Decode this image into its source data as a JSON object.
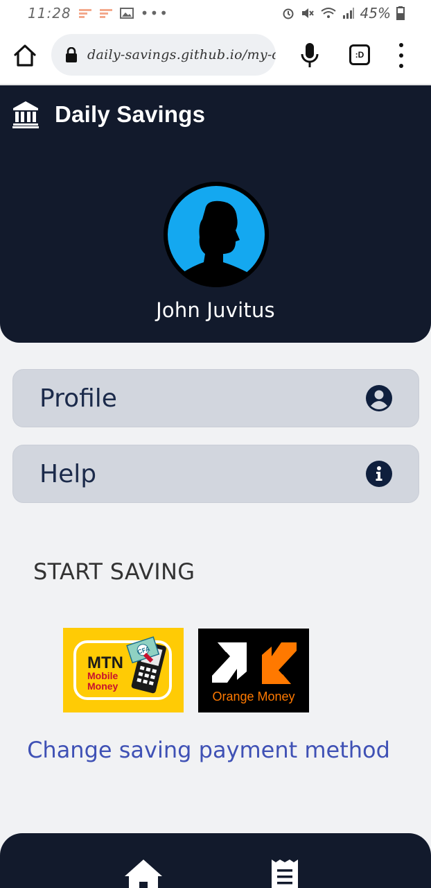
{
  "status_bar": {
    "time": "11:28",
    "battery": "45%"
  },
  "browser": {
    "url": "daily-savings.github.io/my-d",
    "tab_label": ":D"
  },
  "header": {
    "app_title": "Daily Savings",
    "user_name": "John Juvitus"
  },
  "menu": {
    "profile_label": "Profile",
    "help_label": "Help"
  },
  "saving": {
    "section_title": "START SAVING",
    "mtn_line1": "MTN",
    "mtn_line2": "Mobile",
    "mtn_line3": "Money",
    "mtn_badge": "CFA",
    "orange_label": "Orange Money",
    "change_link": "Change saving payment method"
  },
  "colors": {
    "header_bg": "#121a2c",
    "page_bg": "#f1f2f4",
    "card_bg": "#d2d6de",
    "card_text": "#1b2a4a",
    "link": "#3f51b5",
    "avatar_bg": "#14a8f0",
    "mtn_yellow": "#ffcb05",
    "orange": "#ff7900"
  },
  "icons": {
    "brand": "bank-icon",
    "profile": "user-circle-icon",
    "help": "info-circle-icon",
    "nav_home": "home-icon",
    "nav_history": "receipt-icon"
  }
}
